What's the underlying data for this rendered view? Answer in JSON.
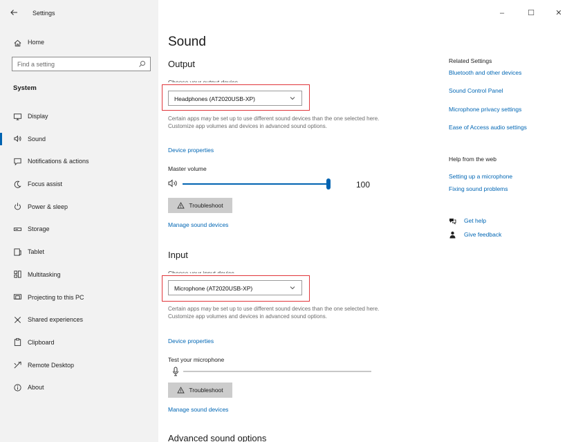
{
  "window": {
    "title": "Settings",
    "controls": {
      "minimize": "–",
      "maximize": "☐",
      "close": "✕"
    }
  },
  "sidebar": {
    "home_label": "Home",
    "search": {
      "placeholder": "Find a setting",
      "value": ""
    },
    "section_title": "System",
    "items": [
      {
        "label": "Display",
        "icon": "display-icon"
      },
      {
        "label": "Sound",
        "icon": "sound-icon",
        "active": true
      },
      {
        "label": "Notifications & actions",
        "icon": "notifications-icon"
      },
      {
        "label": "Focus assist",
        "icon": "focus-assist-icon"
      },
      {
        "label": "Power & sleep",
        "icon": "power-icon"
      },
      {
        "label": "Storage",
        "icon": "storage-icon"
      },
      {
        "label": "Tablet",
        "icon": "tablet-icon"
      },
      {
        "label": "Multitasking",
        "icon": "multitasking-icon"
      },
      {
        "label": "Projecting to this PC",
        "icon": "projecting-icon"
      },
      {
        "label": "Shared experiences",
        "icon": "shared-experiences-icon"
      },
      {
        "label": "Clipboard",
        "icon": "clipboard-icon"
      },
      {
        "label": "Remote Desktop",
        "icon": "remote-desktop-icon"
      },
      {
        "label": "About",
        "icon": "about-icon"
      }
    ]
  },
  "main": {
    "page_title": "Sound",
    "output": {
      "heading": "Output",
      "choose_label": "Choose your output device",
      "device": "Headphones (AT2020USB-XP)",
      "description": "Certain apps may be set up to use different sound devices than the one selected here. Customize app volumes and devices in advanced sound options.",
      "device_properties": "Device properties",
      "master_volume_label": "Master volume",
      "volume": 100,
      "volume_text": "100",
      "troubleshoot": "Troubleshoot",
      "manage": "Manage sound devices"
    },
    "input": {
      "heading": "Input",
      "choose_label": "Choose your input device",
      "device": "Microphone (AT2020USB-XP)",
      "description": "Certain apps may be set up to use different sound devices than the one selected here. Customize app volumes and devices in advanced sound options.",
      "device_properties": "Device properties",
      "test_label": "Test your microphone",
      "mic_level": 0,
      "troubleshoot": "Troubleshoot",
      "manage": "Manage sound devices"
    },
    "advanced_heading": "Advanced sound options"
  },
  "related": {
    "heading": "Related Settings",
    "links": [
      "Bluetooth and other devices",
      "Sound Control Panel",
      "Microphone privacy settings",
      "Ease of Access audio settings"
    ],
    "help_heading": "Help from the web",
    "help_links": [
      "Setting up a microphone",
      "Fixing sound problems"
    ],
    "get_help": "Get help",
    "give_feedback": "Give feedback"
  },
  "colors": {
    "accent": "#0063b1",
    "link": "#0066b4",
    "highlight": "#e0353a",
    "sidebar_bg": "#f2f2f2"
  }
}
